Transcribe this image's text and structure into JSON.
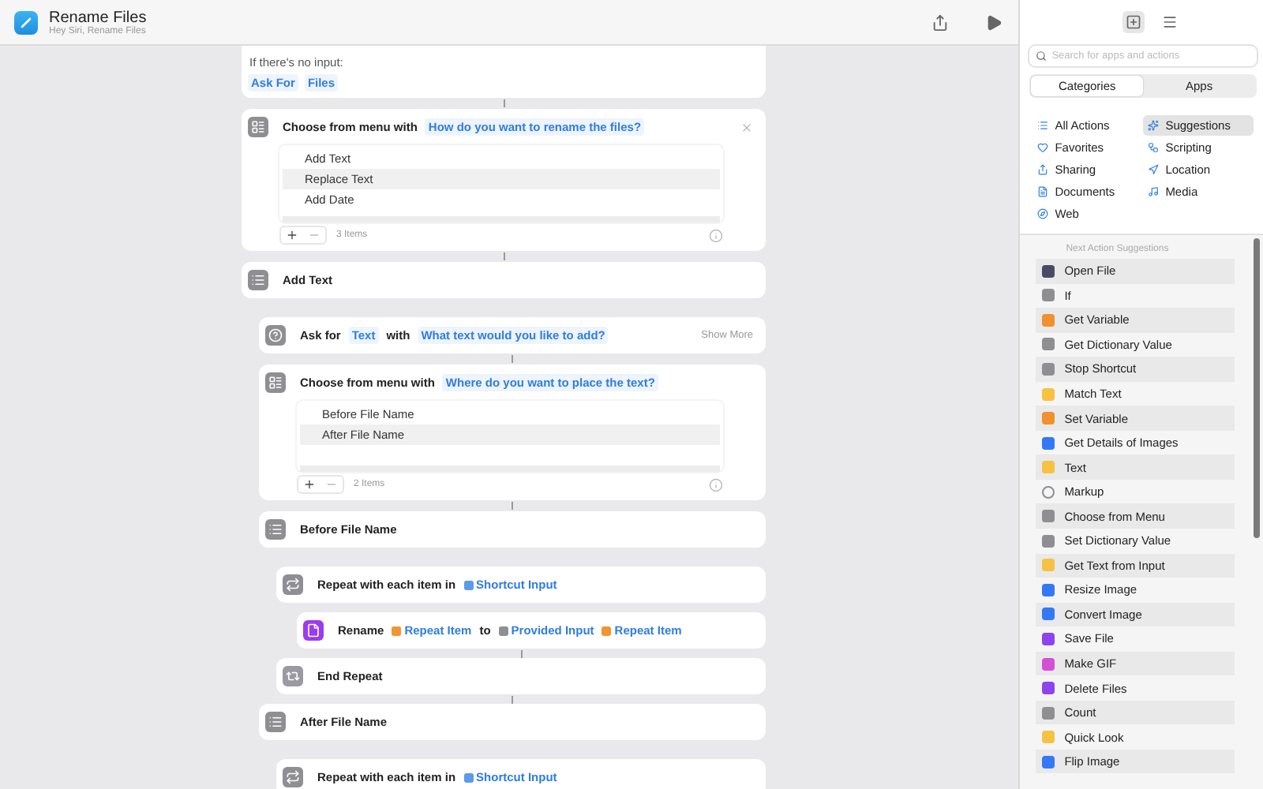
{
  "window": {
    "title": "Rename Files",
    "subtitle": "Hey Siri, Rename Files"
  },
  "steps": [
    {
      "kind": "fallback",
      "label": "If there's no input:",
      "params": [
        "Ask For",
        "Files"
      ]
    },
    {
      "kind": "menu",
      "close_button": true,
      "parts": [
        {
          "kind": "text",
          "text": "Choose from menu with"
        },
        {
          "kind": "param",
          "text": "How do you want to rename the files?"
        }
      ],
      "options": [
        {
          "label": "Add Text",
          "selected": false
        },
        {
          "label": "Replace Text",
          "selected": true
        },
        {
          "label": "Add Date",
          "selected": false
        }
      ],
      "count": "3 Items"
    },
    {
      "kind": "case",
      "parts": [
        {
          "kind": "text",
          "text": "Add Text"
        }
      ],
      "children": [
        {
          "kind": "ask",
          "parts": [
            {
              "kind": "text",
              "text": "Ask for"
            },
            {
              "kind": "param",
              "text": "Text"
            },
            {
              "kind": "text",
              "text": "with"
            },
            {
              "kind": "param",
              "text": "What text would you like to add?"
            }
          ],
          "more": "Show More"
        },
        {
          "kind": "menu",
          "close_button": false,
          "parts": [
            {
              "kind": "text",
              "text": "Choose from menu with"
            },
            {
              "kind": "param",
              "text": "Where do you want to place the text?"
            }
          ],
          "options": [
            {
              "label": "Before File Name",
              "selected": false
            },
            {
              "label": "After File Name",
              "selected": true
            }
          ],
          "count": "2 Items"
        },
        {
          "kind": "case",
          "parts": [
            {
              "kind": "text",
              "text": "Before File Name"
            }
          ],
          "children": [
            {
              "kind": "repeat",
              "parts": [
                {
                  "kind": "text",
                  "text": "Repeat with each item in"
                },
                {
                  "kind": "variable",
                  "text": "Shortcut Input",
                  "color": "#5b9bea"
                }
              ],
              "children": [
                {
                  "kind": "rename",
                  "parts": [
                    {
                      "kind": "text",
                      "text": "Rename"
                    },
                    {
                      "kind": "variable",
                      "text": "Repeat Item",
                      "color": "#f0962f"
                    },
                    {
                      "kind": "text",
                      "text": "to"
                    },
                    {
                      "kind": "variable",
                      "text": "Provided Input",
                      "color": "#8e8e93"
                    },
                    {
                      "kind": "variable",
                      "text": "Repeat Item",
                      "color": "#f0962f"
                    }
                  ]
                }
              ]
            },
            {
              "kind": "end",
              "parts": [
                {
                  "kind": "text",
                  "text": "End Repeat"
                }
              ]
            }
          ]
        },
        {
          "kind": "case",
          "parts": [
            {
              "kind": "text",
              "text": "After File Name"
            }
          ],
          "children": [
            {
              "kind": "repeat",
              "parts": [
                {
                  "kind": "text",
                  "text": "Repeat with each item in"
                },
                {
                  "kind": "variable",
                  "text": "Shortcut Input",
                  "color": "#5b9bea"
                }
              ]
            }
          ]
        }
      ]
    }
  ],
  "sidebar": {
    "search": {
      "placeholder": "Search for apps and actions"
    },
    "segments": [
      {
        "label": "Categories",
        "selected": true
      },
      {
        "label": "Apps",
        "selected": false
      }
    ],
    "categories": [
      {
        "label": "All Actions",
        "selected": false
      },
      {
        "label": "Suggestions",
        "selected": true
      },
      {
        "label": "Favorites",
        "selected": false
      },
      {
        "label": "Scripting",
        "selected": false
      },
      {
        "label": "Sharing",
        "selected": false
      },
      {
        "label": "Location",
        "selected": false
      },
      {
        "label": "Documents",
        "selected": false
      },
      {
        "label": "Media",
        "selected": false
      },
      {
        "label": "Web",
        "selected": false
      }
    ],
    "suggestions_title": "Next Action Suggestions",
    "suggestions": [
      {
        "label": "Open File",
        "kind": "filled",
        "color": "#4a4a68"
      },
      {
        "label": "If",
        "kind": "filled",
        "color": "#8e8e93"
      },
      {
        "label": "Get Variable",
        "kind": "filled",
        "color": "#f0902e"
      },
      {
        "label": "Get Dictionary Value",
        "kind": "filled",
        "color": "#8e8e93"
      },
      {
        "label": "Stop Shortcut",
        "kind": "filled",
        "color": "#8e8e93"
      },
      {
        "label": "Match Text",
        "kind": "filled",
        "color": "#f5c242"
      },
      {
        "label": "Set Variable",
        "kind": "filled",
        "color": "#f0902e"
      },
      {
        "label": "Get Details of Images",
        "kind": "filled",
        "color": "#3478f6"
      },
      {
        "label": "Text",
        "kind": "filled",
        "color": "#f5c242"
      },
      {
        "label": "Markup",
        "kind": "outline",
        "color": "#8e8e93"
      },
      {
        "label": "Choose from Menu",
        "kind": "filled",
        "color": "#8e8e93"
      },
      {
        "label": "Set Dictionary Value",
        "kind": "filled",
        "color": "#8e8e93"
      },
      {
        "label": "Get Text from Input",
        "kind": "filled",
        "color": "#f5c242"
      },
      {
        "label": "Resize Image",
        "kind": "filled",
        "color": "#3478f6"
      },
      {
        "label": "Convert Image",
        "kind": "filled",
        "color": "#3478f6"
      },
      {
        "label": "Save File",
        "kind": "filled",
        "color": "#8e44ec"
      },
      {
        "label": "Make GIF",
        "kind": "filled",
        "color": "#d44fd6"
      },
      {
        "label": "Delete Files",
        "kind": "filled",
        "color": "#8e44ec"
      },
      {
        "label": "Count",
        "kind": "filled",
        "color": "#8e8e93"
      },
      {
        "label": "Quick Look",
        "kind": "filled",
        "color": "#f5c242"
      },
      {
        "label": "Flip Image",
        "kind": "filled",
        "color": "#3478f6"
      }
    ]
  }
}
